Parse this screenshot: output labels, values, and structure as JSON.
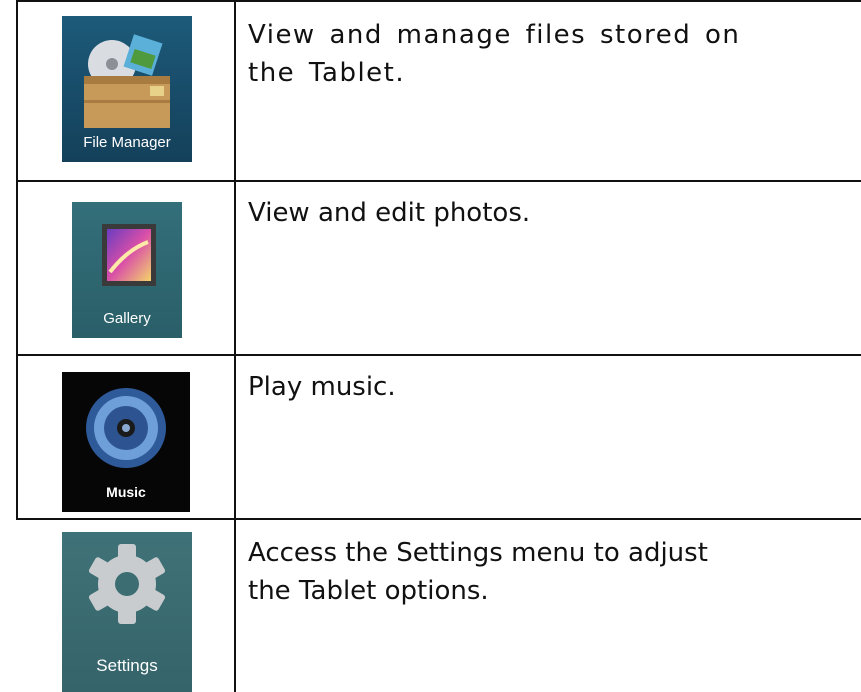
{
  "rows": [
    {
      "icon": "file-manager-icon",
      "label": "File Manager",
      "description": "View and manage files stored on the Tablet."
    },
    {
      "icon": "gallery-icon",
      "label": "Gallery",
      "description": "View and edit photos."
    },
    {
      "icon": "music-icon",
      "label": "Music",
      "description": "Play music."
    },
    {
      "icon": "settings-icon",
      "label": "Settings",
      "description": "Access the Settings menu to adjust the Tablet options."
    }
  ],
  "colors": {
    "border": "#111111",
    "file_manager_bg": "#1b4f6b",
    "gallery_bg": "#2f6a74",
    "music_bg": "#050505",
    "settings_bg": "#3d6d72"
  }
}
